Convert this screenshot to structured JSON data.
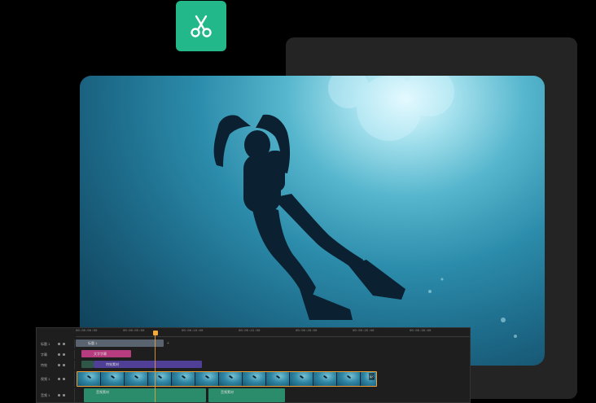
{
  "toolbar": {
    "cut_icon": "scissors-icon",
    "accent_color": "#23b889"
  },
  "preview": {
    "scene": "silhouette of scuba diver swimming upward under sunlit water"
  },
  "timeline": {
    "ruler_ticks": [
      "00:00:00:00",
      "00:00:05:00",
      "00:00:10:00",
      "00:00:15:00",
      "00:00:20:00",
      "00:00:25:00",
      "00:00:30:00"
    ],
    "tracks": [
      {
        "name": "标题 1"
      },
      {
        "name": "字幕"
      },
      {
        "name": "特效"
      },
      {
        "name": "视频 1"
      },
      {
        "name": "音频 1"
      }
    ],
    "clips": {
      "title_clip": "标题 1",
      "caption_clip": "文字字幕",
      "effect_clip": "特效素材",
      "audio_clip_1": "音频素材",
      "audio_clip_2": "音频素材",
      "video_clip_badge": "4K"
    },
    "playhead_color": "#f4a93b"
  }
}
